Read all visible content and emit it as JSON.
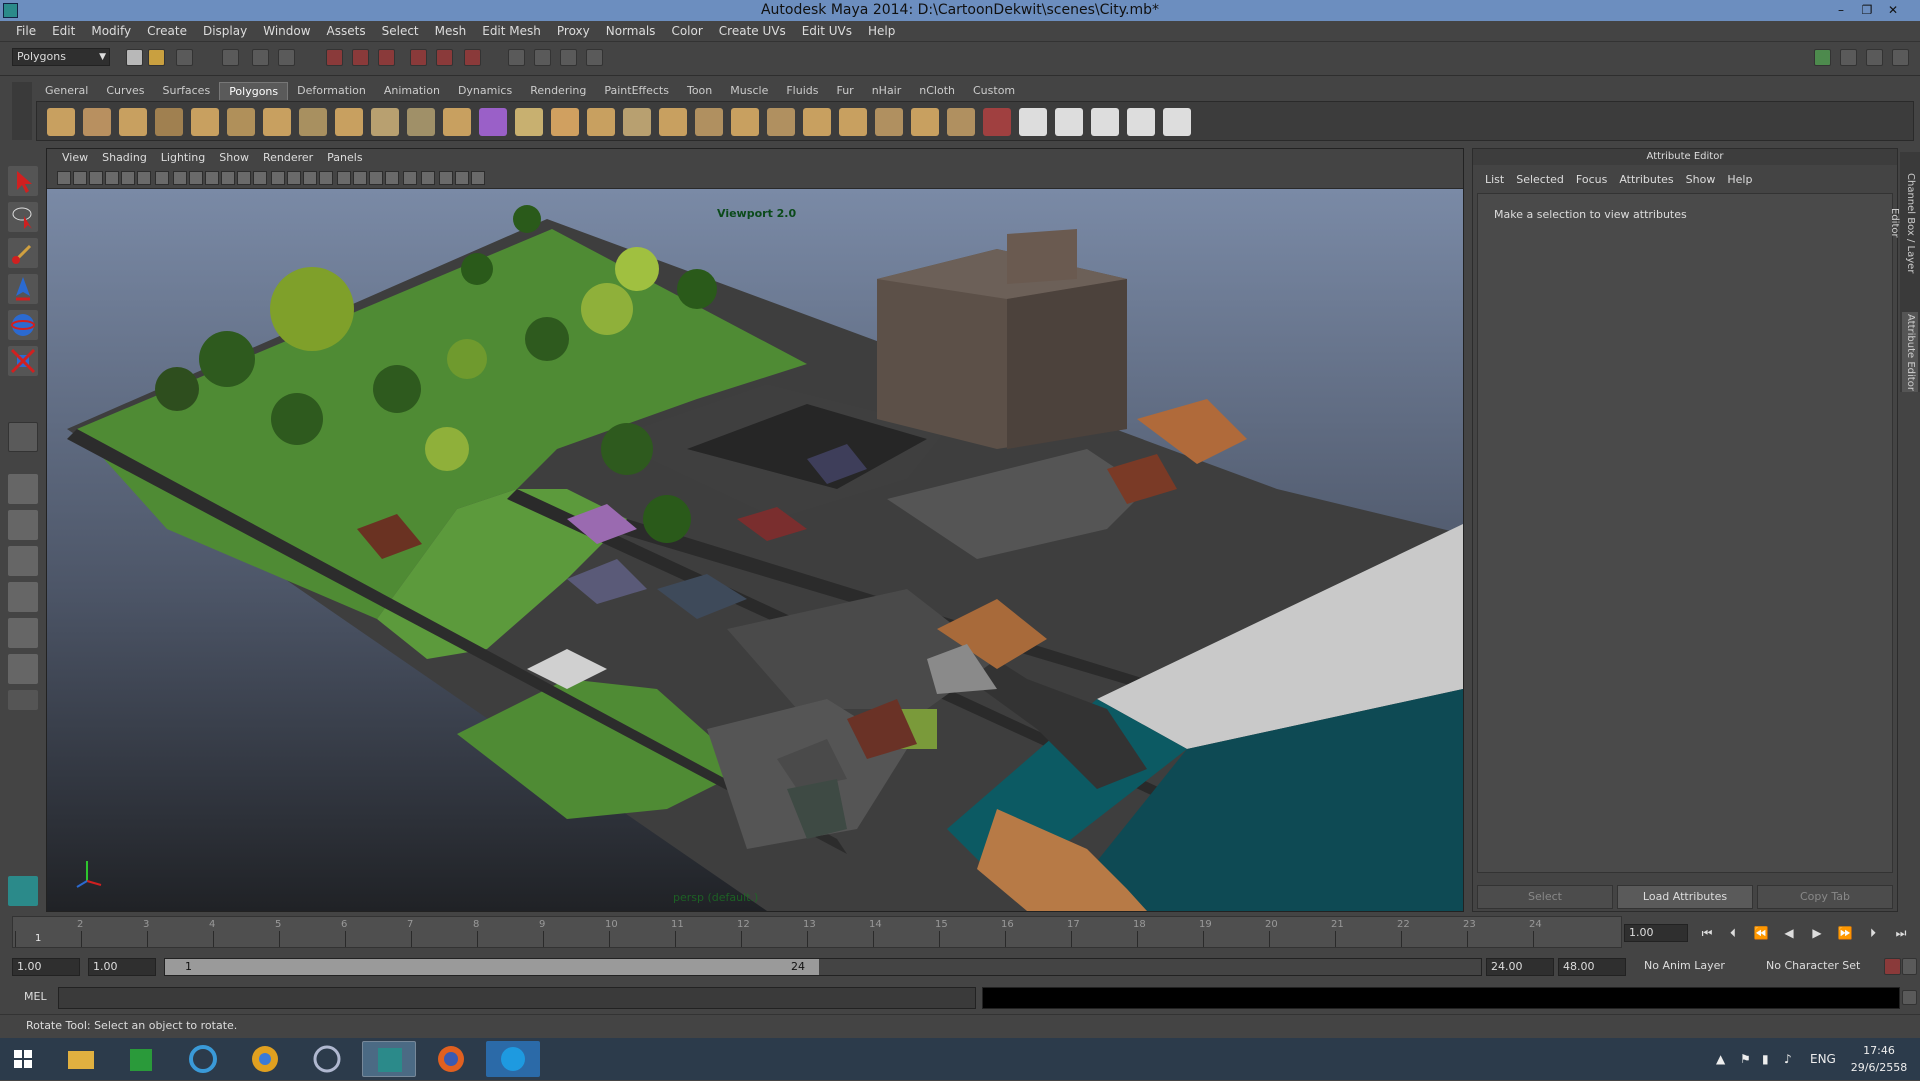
{
  "window": {
    "title": "Autodesk Maya 2014: D:\\CartoonDekwit\\scenes\\City.mb*"
  },
  "menus": [
    "File",
    "Edit",
    "Modify",
    "Create",
    "Display",
    "Window",
    "Assets",
    "Select",
    "Mesh",
    "Edit Mesh",
    "Proxy",
    "Normals",
    "Color",
    "Create UVs",
    "Edit UVs",
    "Help"
  ],
  "status": {
    "mode": "Polygons"
  },
  "shelf": {
    "tabs": [
      "General",
      "Curves",
      "Surfaces",
      "Polygons",
      "Deformation",
      "Animation",
      "Dynamics",
      "Rendering",
      "PaintEffects",
      "Toon",
      "Muscle",
      "Fluids",
      "Fur",
      "nHair",
      "nCloth",
      "Custom"
    ],
    "active": "Polygons"
  },
  "viewport": {
    "menus": [
      "View",
      "Shading",
      "Lighting",
      "Show",
      "Renderer",
      "Panels"
    ],
    "renderer_label": "Viewport 2.0",
    "camera_label": "persp (default.)"
  },
  "attribute_editor": {
    "title": "Attribute Editor",
    "menus": [
      "List",
      "Selected",
      "Focus",
      "Attributes",
      "Show",
      "Help"
    ],
    "empty_message": "Make a selection to view attributes",
    "buttons": {
      "select": "Select",
      "load": "Load Attributes",
      "copy": "Copy Tab"
    }
  },
  "side_tabs": {
    "channel_box": "Channel Box / Layer Editor",
    "attribute_editor": "Attribute Editor"
  },
  "timeline": {
    "ticks": [
      "1",
      "2",
      "3",
      "4",
      "5",
      "6",
      "7",
      "8",
      "9",
      "10",
      "11",
      "12",
      "13",
      "14",
      "15",
      "16",
      "17",
      "18",
      "19",
      "20",
      "21",
      "22",
      "23",
      "24"
    ],
    "current_frame": "1.00",
    "start_label": "1"
  },
  "range": {
    "start_time": "1.00",
    "playback_start": "1.00",
    "slider_start": "1",
    "slider_end": "24",
    "playback_end": "24.00",
    "end_time": "48.00",
    "anim_layer": "No Anim Layer",
    "character_set": "No Character Set"
  },
  "command_line": {
    "label": "MEL"
  },
  "help_line": {
    "text": "Rotate Tool: Select an object to rotate."
  },
  "taskbar": {
    "language": "ENG",
    "time": "17:46",
    "date": "29/6/2558"
  }
}
